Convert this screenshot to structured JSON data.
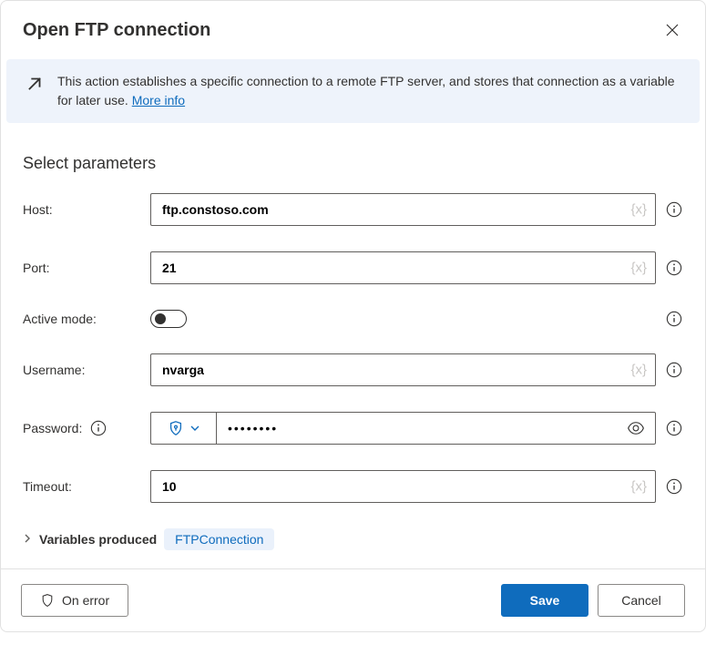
{
  "dialog": {
    "title": "Open FTP connection"
  },
  "banner": {
    "text": "This action establishes a specific connection to a remote FTP server, and stores that connection as a variable for later use.",
    "more_label": "More info"
  },
  "section": {
    "title": "Select parameters"
  },
  "form": {
    "host": {
      "label": "Host:",
      "value": "ftp.constoso.com"
    },
    "port": {
      "label": "Port:",
      "value": "21"
    },
    "active_mode": {
      "label": "Active mode:"
    },
    "username": {
      "label": "Username:",
      "value": "nvarga"
    },
    "password": {
      "label": "Password:",
      "value": "••••••••"
    },
    "timeout": {
      "label": "Timeout:",
      "value": "10"
    },
    "var_hint": "{x}"
  },
  "vars_produced": {
    "label": "Variables produced",
    "badge": "FTPConnection"
  },
  "footer": {
    "on_error": "On error",
    "save": "Save",
    "cancel": "Cancel"
  }
}
